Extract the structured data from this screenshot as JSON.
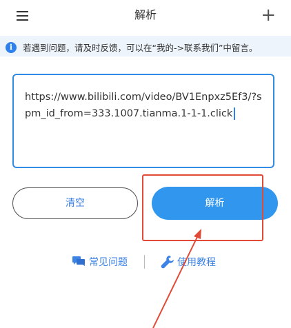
{
  "header": {
    "title": "解析",
    "menu_icon": "hamburger-menu-icon",
    "add_icon": "plus-icon",
    "add_label": "+"
  },
  "notice": {
    "icon": "info-icon",
    "icon_glyph": "i",
    "text": "若遇到问题，请及时反馈，可以在“我的->联系我们”中留言。"
  },
  "url_input": {
    "value": "https://www.bilibili.com/video/BV1Enpxz5Ef3/?spm_id_from=333.1007.tianma.1-1-1.click"
  },
  "buttons": {
    "clear_label": "清空",
    "parse_label": "解析"
  },
  "links": {
    "faq_label": "常见问题",
    "faq_icon": "chat-bubbles-icon",
    "tutorial_label": "使用教程",
    "tutorial_icon": "wrench-icon"
  },
  "annotation": {
    "highlight_color": "#e04a36"
  },
  "colors": {
    "accent": "#3197ee",
    "link": "#3d83e5"
  }
}
